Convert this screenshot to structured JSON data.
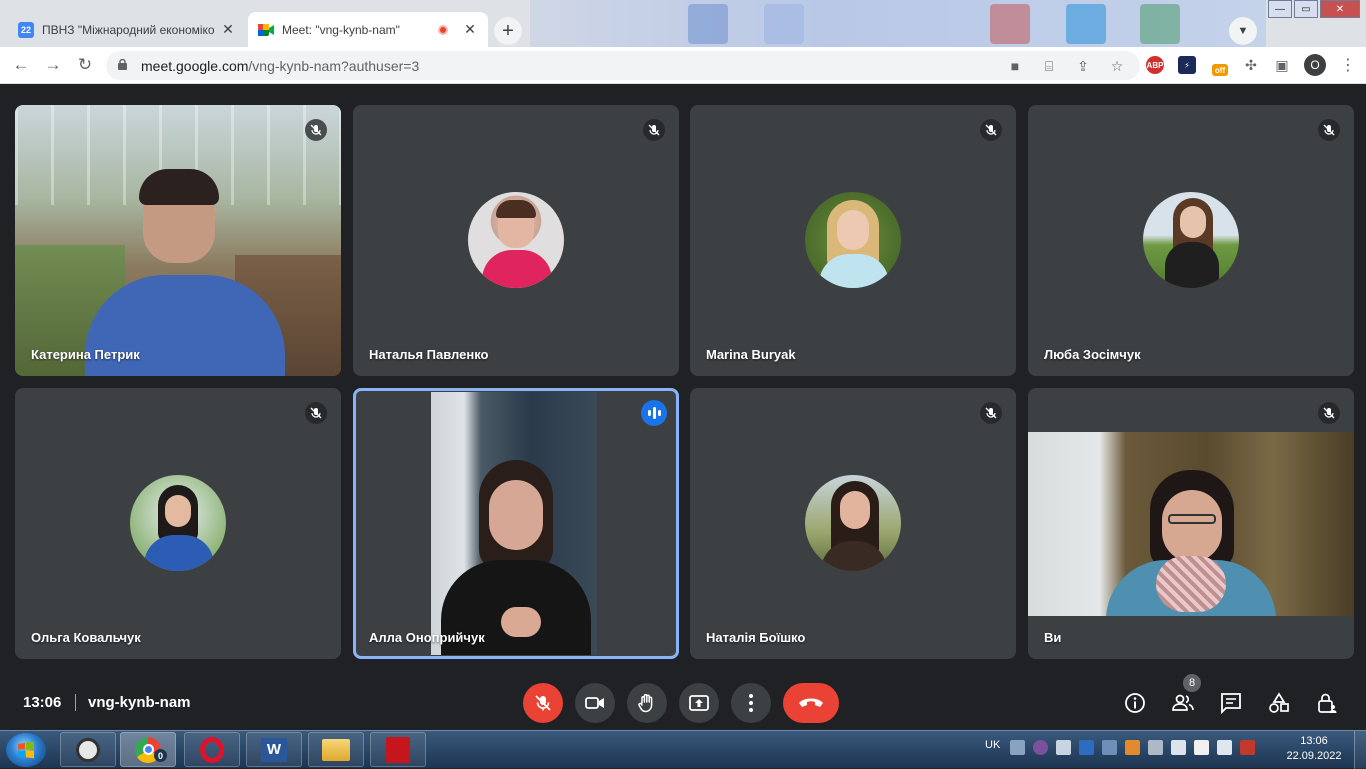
{
  "browser": {
    "tabs": [
      {
        "title": "ПВНЗ \"Міжнародний економіко",
        "favicon_label": "22"
      },
      {
        "title": "Meet: \"vng-kynb-nam\""
      }
    ],
    "url": {
      "host": "meet.google.com",
      "path": "/vng-kynb-nam?authuser=3"
    },
    "profile_initial": "O",
    "extensions": {
      "abp": "ABP",
      "off": "off"
    }
  },
  "participants": [
    {
      "name": "Катерина Петрик",
      "state": "muted",
      "view": "video"
    },
    {
      "name": "Наталья Павленко",
      "state": "muted",
      "view": "avatar"
    },
    {
      "name": "Marina Buryak",
      "state": "muted",
      "view": "avatar"
    },
    {
      "name": "Люба Зосімчук",
      "state": "muted",
      "view": "avatar"
    },
    {
      "name": "Ольга Ковальчук",
      "state": "muted",
      "view": "avatar"
    },
    {
      "name": "Алла Оноприйчук",
      "state": "speaking",
      "view": "video"
    },
    {
      "name": "Наталія Боїшко",
      "state": "muted",
      "view": "avatar"
    },
    {
      "name": "Ви",
      "state": "muted",
      "view": "video"
    }
  ],
  "meeting": {
    "time": "13:06",
    "code": "vng-kynb-nam",
    "participant_count": "8"
  },
  "taskbar": {
    "language": "UK",
    "time": "13:06",
    "date": "22.09.2022",
    "apps": [
      "skype",
      "chrome",
      "opera",
      "word",
      "explorer",
      "acrobat"
    ],
    "word_label": "W",
    "chrome_badge": "0"
  },
  "colors": {
    "meet_bg": "#202124",
    "tile_bg": "#3c4043",
    "red": "#ea4335",
    "speaking_outline": "#8ab4f8",
    "talk_blue": "#1a73e8"
  }
}
